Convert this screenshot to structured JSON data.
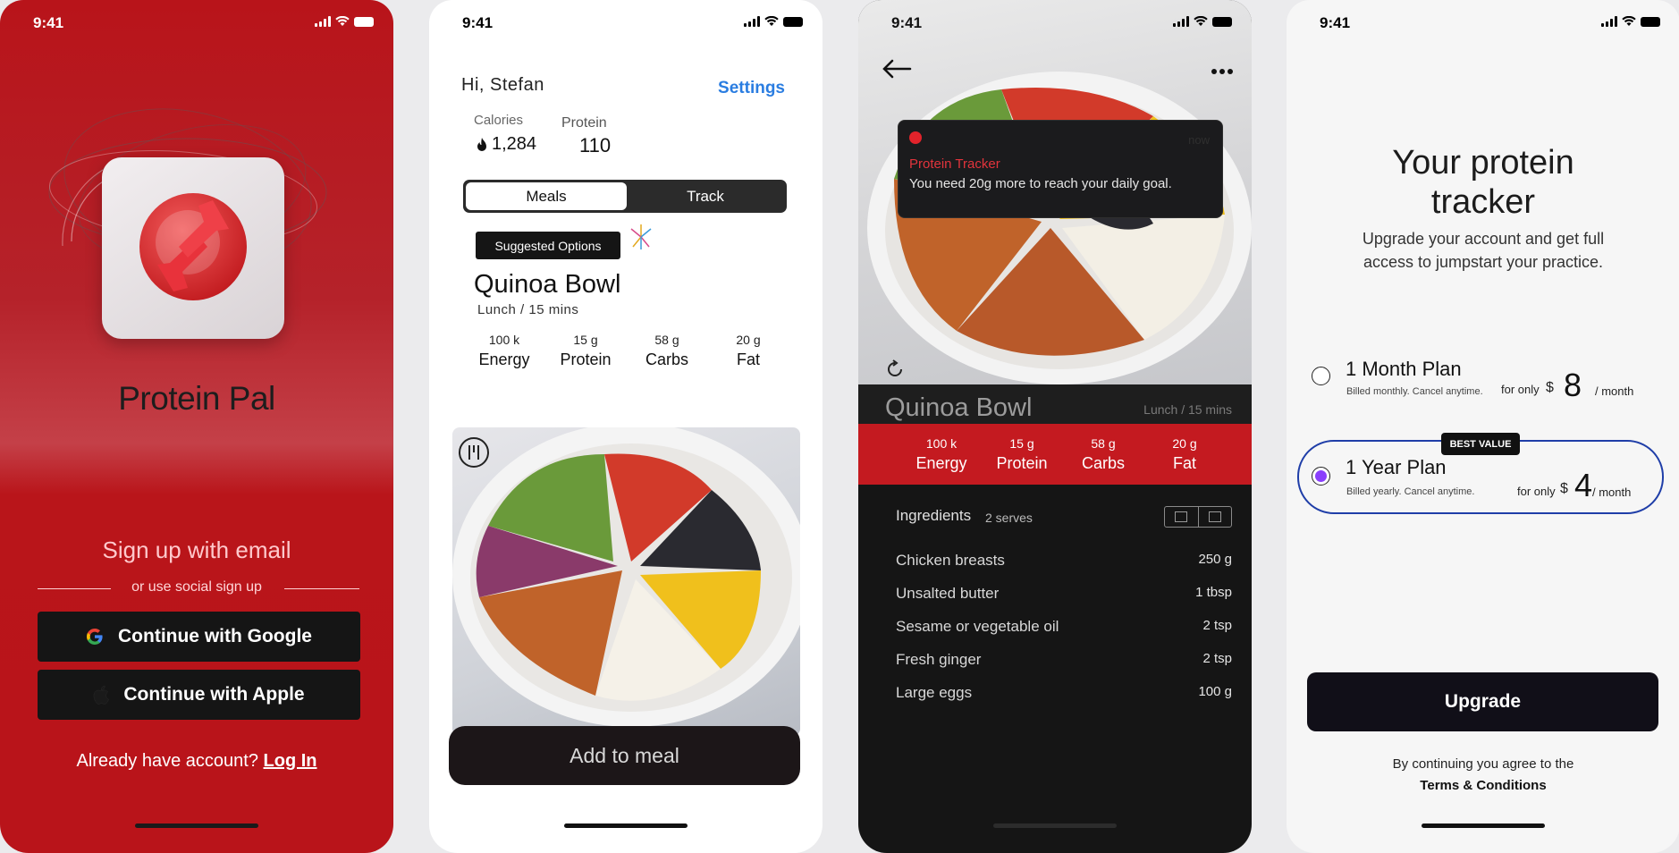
{
  "status": {
    "time": "9:41"
  },
  "screen1": {
    "app_name": "Protein Pal",
    "signup_email": "Sign up with email",
    "or_social": "or use social sign up",
    "google_button": "Continue with Google",
    "apple_button": "Continue with Apple",
    "have_account": "Already have account?",
    "login_link": "Log In"
  },
  "screen2": {
    "greeting": "Hi, Stefan",
    "settings": "Settings",
    "calories_label": "Calories",
    "calories_value": "1,284",
    "protein_label": "Protein",
    "protein_value": "110",
    "tabs": [
      "Meals",
      "Track"
    ],
    "suggested": "Suggested Options",
    "meal_title": "Quinoa Bowl",
    "meal_sub": "Lunch / 15 mins",
    "macros": [
      {
        "value": "100 k",
        "label": "Energy"
      },
      {
        "value": "15 g",
        "label": "Protein"
      },
      {
        "value": "58 g",
        "label": "Carbs"
      },
      {
        "value": "20 g",
        "label": "Fat"
      }
    ],
    "add_button": "Add to meal"
  },
  "screen3": {
    "notif_app": "Protein Tracker",
    "notif_time": "now",
    "notif_msg": "You need 20g more to reach your daily goal.",
    "meal_title": "Quinoa Bowl",
    "meal_sub": "Lunch / 15 mins",
    "macros": [
      {
        "value": "100 k",
        "label": "Energy"
      },
      {
        "value": "15 g",
        "label": "Protein"
      },
      {
        "value": "58 g",
        "label": "Carbs"
      },
      {
        "value": "20 g",
        "label": "Fat"
      }
    ],
    "ingredients_label": "Ingredients",
    "serves": "2 serves",
    "ingredients": [
      {
        "name": "Chicken breasts",
        "qty": "250 g"
      },
      {
        "name": "Unsalted butter",
        "qty": "1 tbsp"
      },
      {
        "name": "Sesame or vegetable oil",
        "qty": "2 tsp"
      },
      {
        "name": "Fresh ginger",
        "qty": "2 tsp"
      },
      {
        "name": "Large eggs",
        "qty": "100 g"
      }
    ]
  },
  "screen4": {
    "title": "Your protein tracker",
    "subtitle": "Upgrade your account and get full access to jumpstart your practice.",
    "plans": [
      {
        "name": "1 Month Plan",
        "note": "Billed monthly. Cancel anytime.",
        "for_only": "for only",
        "currency": "$",
        "price": "8",
        "per": "/ month",
        "selected": false
      },
      {
        "name": "1 Year Plan",
        "note": "Billed yearly. Cancel anytime.",
        "for_only": "for only",
        "currency": "$",
        "price": "4",
        "per": "/ month",
        "selected": true,
        "badge": "BEST VALUE"
      }
    ],
    "upgrade_button": "Upgrade",
    "agree": "By continuing you agree to the",
    "terms": "Terms & Conditions"
  },
  "colors": {
    "brand_red": "#b9141a",
    "accent_blue": "#2a7de1",
    "plan_border": "#1f3ea8",
    "radio_purple": "#8a3ffc"
  }
}
